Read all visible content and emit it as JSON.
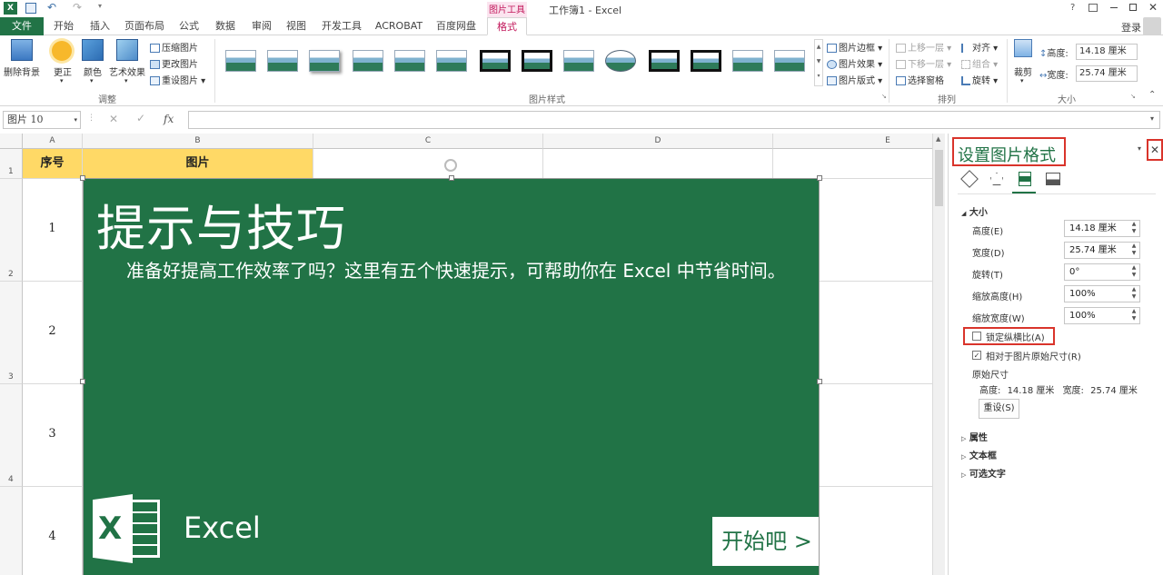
{
  "titlebar": {
    "doc_title": "工作簿1 - Excel",
    "context_tab_group": "图片工具",
    "help": "?",
    "signin": "登录"
  },
  "tabs": [
    "文件",
    "开始",
    "插入",
    "页面布局",
    "公式",
    "数据",
    "审阅",
    "视图",
    "开发工具",
    "ACROBAT",
    "百度网盘",
    "格式"
  ],
  "ribbon": {
    "adjust": {
      "remove_bg": "删除背景",
      "corrections": "更正",
      "color": "颜色",
      "artistic": "艺术效果",
      "compress": "压缩图片",
      "change": "更改图片",
      "reset": "重设图片",
      "label": "调整"
    },
    "styles": {
      "label": "图片样式",
      "border": "图片边框",
      "effects": "图片效果",
      "layout": "图片版式"
    },
    "arrange": {
      "label": "排列",
      "bring_forward": "上移一层",
      "send_backward": "下移一层",
      "selection_pane": "选择窗格",
      "align": "对齐",
      "group": "组合",
      "rotate": "旋转"
    },
    "size": {
      "label": "大小",
      "crop": "裁剪",
      "height_label": "高度:",
      "height_value": "14.18 厘米",
      "width_label": "宽度:",
      "width_value": "25.74 厘米"
    }
  },
  "formula_bar": {
    "name_box": "图片 10",
    "fx": "fx",
    "value": ""
  },
  "grid": {
    "columns": [
      "A",
      "B",
      "C",
      "D",
      "E"
    ],
    "rows": [
      "1",
      "2",
      "3",
      "4"
    ],
    "header_a": "序号",
    "header_b": "图片",
    "seq": [
      "1",
      "2",
      "3",
      "4"
    ]
  },
  "picture": {
    "title": "提示与技巧",
    "body": "准备好提高工作效率了吗？这里有五个快速提示，可帮助你在 Excel 中节省时间。",
    "app_name": "Excel",
    "start_button": "开始吧 >",
    "bg_color": "#217346"
  },
  "pane": {
    "title": "设置图片格式",
    "section_size": "大小",
    "fields": [
      {
        "label": "高度(E)",
        "value": "14.18 厘米"
      },
      {
        "label": "宽度(D)",
        "value": "25.74 厘米"
      },
      {
        "label": "旋转(T)",
        "value": "0°"
      },
      {
        "label": "缩放高度(H)",
        "value": "100%"
      },
      {
        "label": "缩放宽度(W)",
        "value": "100%"
      }
    ],
    "lock_aspect": "锁定纵横比(A)",
    "relative_original": "相对于图片原始尺寸(R)",
    "original_size": "原始尺寸",
    "original_height_label": "高度:",
    "original_height": "14.18 厘米",
    "original_width_label": "宽度:",
    "original_width": "25.74 厘米",
    "reset_button": "重设(S)",
    "sections": [
      "属性",
      "文本框",
      "可选文字"
    ],
    "close": "✕"
  },
  "colors": {
    "excel_green": "#217346",
    "header_yellow": "#ffd966",
    "highlight_red": "#d9342b",
    "context_pink": "#c2185b"
  }
}
